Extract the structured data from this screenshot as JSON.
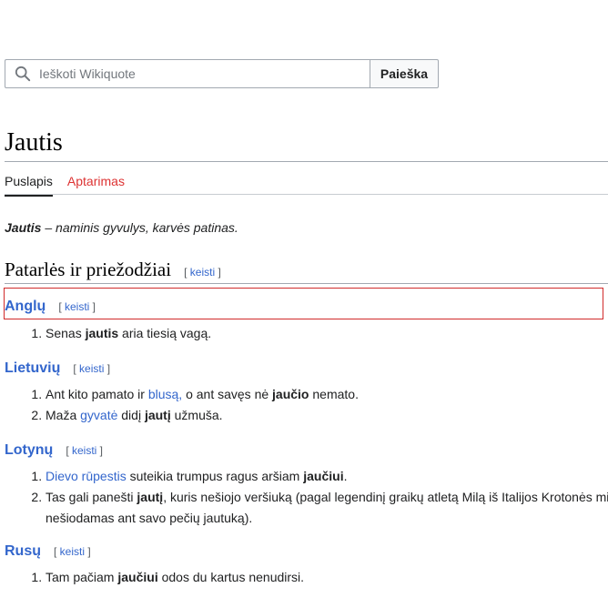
{
  "search": {
    "placeholder": "Ieškoti Wikiquote",
    "button_label": "Paieška"
  },
  "page_title": "Jautis",
  "tabs": [
    {
      "label": "Puslapis"
    },
    {
      "label": "Aptarimas"
    }
  ],
  "intro": {
    "bold": "Jautis",
    "rest": " – naminis gyvulys, karvės patinas."
  },
  "section": {
    "title": "Patarlės ir priežodžiai",
    "edit": "keisti"
  },
  "edit_bracket_open": "[ ",
  "edit_bracket_close": " ]",
  "subsections": [
    {
      "title": "Anglų",
      "edit": "keisti",
      "items": [
        [
          {
            "t": "Senas "
          },
          {
            "t": "jautis",
            "b": true
          },
          {
            "t": " aria tiesią vagą."
          }
        ]
      ]
    },
    {
      "title": "Lietuvių",
      "edit": "keisti",
      "items": [
        [
          {
            "t": "Ant kito pamato ir "
          },
          {
            "t": "blusą,",
            "link": true
          },
          {
            "t": " o ant savęs nė "
          },
          {
            "t": "jaučio",
            "b": true
          },
          {
            "t": " nemato."
          }
        ],
        [
          {
            "t": "Maža "
          },
          {
            "t": "gyvatė",
            "link": true
          },
          {
            "t": " didį "
          },
          {
            "t": "jautį",
            "b": true
          },
          {
            "t": " užmuša."
          }
        ]
      ]
    },
    {
      "title": "Lotynų",
      "edit": "keisti",
      "items": [
        [
          {
            "t": "Dievo rūpestis",
            "link": true
          },
          {
            "t": " suteikia trumpus ragus aršiam "
          },
          {
            "t": "jaučiui",
            "b": true
          },
          {
            "t": "."
          }
        ],
        [
          {
            "t": "Tas gali panešti "
          },
          {
            "t": "jautį",
            "b": true
          },
          {
            "t": ", kuris nešiojo veršiuką (pagal legendinį graikų atletą Milą iš Italijos Krotonės mi"
          },
          {
            "t": "nešiodamas ant savo pečių jautuką).",
            "nl": true
          }
        ]
      ]
    },
    {
      "title": "Rusų",
      "edit": "keisti",
      "items": [
        [
          {
            "t": "Tam pačiam "
          },
          {
            "t": "jaučiui",
            "b": true
          },
          {
            "t": " odos du kartus nenudirsi."
          }
        ]
      ]
    }
  ]
}
